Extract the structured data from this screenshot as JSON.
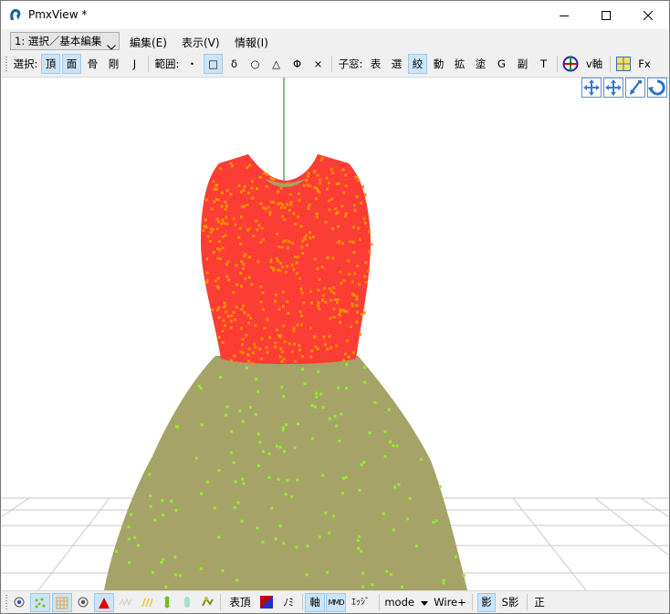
{
  "window": {
    "title": "PmxView *"
  },
  "menubar": {
    "mode_select": "1: 選択／基本編集",
    "edit": "編集(E)",
    "display": "表示(V)",
    "info": "情報(I)"
  },
  "toolbar": {
    "select_label": "選択:",
    "vertex": "頂",
    "face": "面",
    "bone": "骨",
    "rigid": "剛",
    "joint": "J",
    "range_label": "範囲:",
    "range_point": "・",
    "range_rect": "□",
    "range_delta": "δ",
    "range_circle": "○",
    "range_triangle": "△",
    "range_phi": "Φ",
    "range_cross": "×",
    "child_label": "子窓:",
    "child_table": "表",
    "child_select": "選",
    "child_pattern": "絞",
    "child_motion": "動",
    "child_extend": "拡",
    "child_paint": "塗",
    "child_g": "G",
    "child_sub": "副",
    "child_t": "T",
    "v_axis": "v軸",
    "fx": "Fx"
  },
  "statusbar": {
    "show_vertex": "表頂",
    "mi": "ﾉﾐ",
    "axis": "軸",
    "mmd": "MMD",
    "edge": "ｴｯｼﾞ",
    "mode": "mode",
    "wire": "Wire+",
    "shadow": "影",
    "s_shadow": "S影",
    "ortho": "正"
  },
  "colors": {
    "bodice": "#fb3d35",
    "skirt": "#a5a368",
    "vertex_orange": "#ff8c00",
    "vertex_green": "#90ee2a",
    "axis_green": "#008000",
    "grid": "#c8c8c8",
    "selected_bg": "#cce4f7"
  }
}
